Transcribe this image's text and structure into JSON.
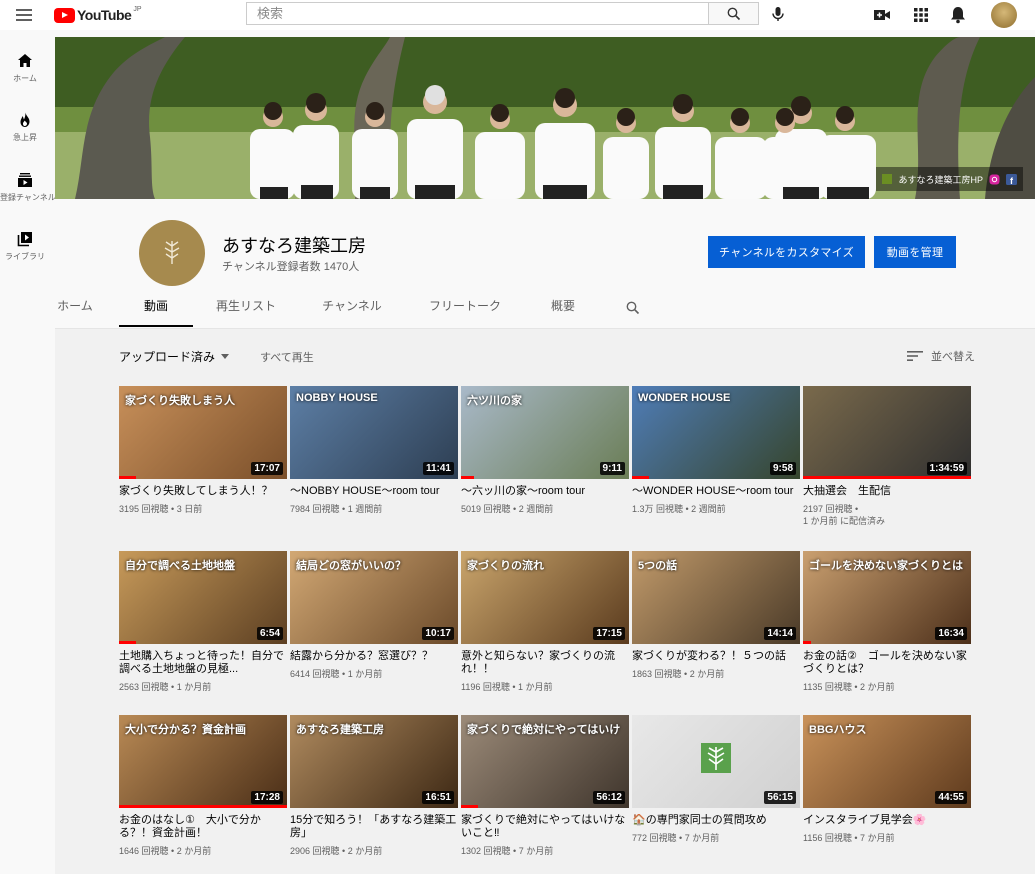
{
  "app": {
    "logo_text": "YouTube",
    "logo_region": "JP",
    "search_placeholder": "検索"
  },
  "sidebar": {
    "items": [
      {
        "label": "ホーム",
        "icon": "home-icon"
      },
      {
        "label": "急上昇",
        "icon": "trending-icon"
      },
      {
        "label": "登録チャンネル",
        "icon": "subscriptions-icon"
      },
      {
        "label": "ライブラリ",
        "icon": "library-icon"
      }
    ]
  },
  "banner": {
    "link_text": "あすなろ建築工房HP"
  },
  "channel": {
    "name": "あすなろ建築工房",
    "subscribers": "チャンネル登録者数 1470人",
    "customize_button": "チャンネルをカスタマイズ",
    "manage_button": "動画を管理"
  },
  "tabs": [
    {
      "label": "ホーム",
      "active": false
    },
    {
      "label": "動画",
      "active": true
    },
    {
      "label": "再生リスト",
      "active": false
    },
    {
      "label": "チャンネル",
      "active": false
    },
    {
      "label": "フリートーク",
      "active": false
    },
    {
      "label": "概要",
      "active": false
    }
  ],
  "toolbar": {
    "uploads_label": "アップロード済み",
    "play_all": "すべて再生",
    "sort_label": "並べ替え"
  },
  "videos": [
    {
      "title": "家づくり失敗してしまう人！？",
      "views": "3195 回視聴",
      "age": "3 日前",
      "duration": "17:07",
      "progress": 0.1,
      "thumb_text": "家づくり失敗しまう人"
    },
    {
      "title": "〜NOBBY HOUSE〜room tour",
      "views": "7984 回視聴",
      "age": "1 週間前",
      "duration": "11:41",
      "progress": 0,
      "thumb_text": "NOBBY HOUSE"
    },
    {
      "title": "〜六ッ川の家〜room tour",
      "views": "5019 回視聴",
      "age": "2 週間前",
      "duration": "9:11",
      "progress": 0.08,
      "thumb_text": "六ツ川の家"
    },
    {
      "title": "〜WONDER HOUSE〜room tour",
      "views": "1.3万 回視聴",
      "age": "2 週間前",
      "duration": "9:58",
      "progress": 0.1,
      "thumb_text": "WONDER HOUSE"
    },
    {
      "title": "大抽選会　生配信",
      "views": "2197 回視聴",
      "age": "1 か月前 に配信済み",
      "duration": "1:34:59",
      "progress": 1.0,
      "thumb_text": ""
    },
    {
      "title": "土地購入ちょっと待った！自分で調べる土地地盤の見極...",
      "views": "2563 回視聴",
      "age": "1 か月前",
      "duration": "6:54",
      "progress": 0.1,
      "thumb_text": "自分で調べる土地地盤"
    },
    {
      "title": "結露から分かる？窓選び？？",
      "views": "6414 回視聴",
      "age": "1 か月前",
      "duration": "10:17",
      "progress": 0,
      "thumb_text": "結局どの窓がいいの？"
    },
    {
      "title": "意外と知らない？家づくりの流れ！！",
      "views": "1196 回視聴",
      "age": "1 か月前",
      "duration": "17:15",
      "progress": 0,
      "thumb_text": "家づくりの流れ"
    },
    {
      "title": "家づくりが変わる？！５つの話",
      "views": "1863 回視聴",
      "age": "2 か月前",
      "duration": "14:14",
      "progress": 0,
      "thumb_text": "5つの話"
    },
    {
      "title": "お金の話②　ゴールを決めない家づくりとは？",
      "views": "1135 回視聴",
      "age": "2 か月前",
      "duration": "16:34",
      "progress": 0.05,
      "thumb_text": "ゴールを決めない家づくりとは"
    },
    {
      "title": "お金のはなし①　大小で分かる？！資金計画！",
      "views": "1646 回視聴",
      "age": "2 か月前",
      "duration": "17:28",
      "progress": 1.0,
      "thumb_text": "大小で分かる？資金計画"
    },
    {
      "title": "15分で知ろう！「あすなろ建築工房」",
      "views": "2906 回視聴",
      "age": "2 か月前",
      "duration": "16:51",
      "progress": 0,
      "thumb_text": "あすなろ建築工房"
    },
    {
      "title": "家づくりで絶対にやってはいけないこと‼",
      "views": "1302 回視聴",
      "age": "7 か月前",
      "duration": "56:12",
      "progress": 0.1,
      "thumb_text": "家づくりで絶対にやってはいけ"
    },
    {
      "title": "🏠の専門家同士の質問攻め",
      "views": "772 回視聴",
      "age": "7 か月前",
      "duration": "56:15",
      "progress": 0,
      "thumb_text": ""
    },
    {
      "title": "インスタライブ見学会🌸",
      "views": "1156 回視聴",
      "age": "7 か月前",
      "duration": "44:55",
      "progress": 0,
      "thumb_text": "BBGハウス"
    }
  ],
  "colors": {
    "accent_blue": "#065fd4",
    "brand_red": "#ff0000",
    "background": "#f9f9f9"
  }
}
